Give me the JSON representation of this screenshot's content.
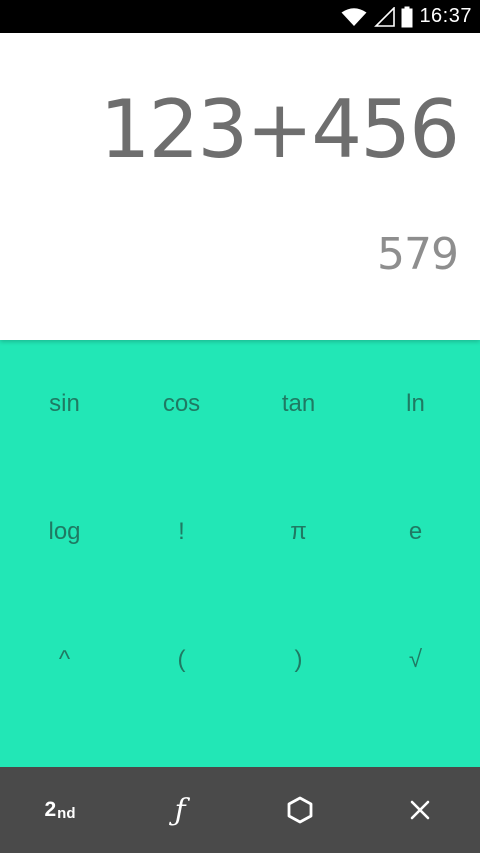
{
  "status_bar": {
    "time": "16:37",
    "icons": [
      "wifi-icon",
      "cell-signal-icon",
      "battery-icon"
    ]
  },
  "display": {
    "formula": "123+456",
    "result": "579"
  },
  "advanced_pad": {
    "keys": [
      "sin",
      "cos",
      "tan",
      "ln",
      "log",
      "!",
      "π",
      "e",
      "^",
      "(",
      ")",
      "√"
    ]
  },
  "bottom_bar": {
    "second_label": "2",
    "second_suffix": "nd",
    "function_label": "ƒ",
    "icons": [
      "hexagon-icon",
      "close-icon"
    ]
  },
  "colors": {
    "pad_background": "#22e7b6",
    "pad_key_text": "#1f7a63",
    "bottom_bar": "#4a4a4a",
    "display_background": "#ffffff",
    "formula_text": "#6e6e6e",
    "result_text": "#8e8e8e"
  }
}
